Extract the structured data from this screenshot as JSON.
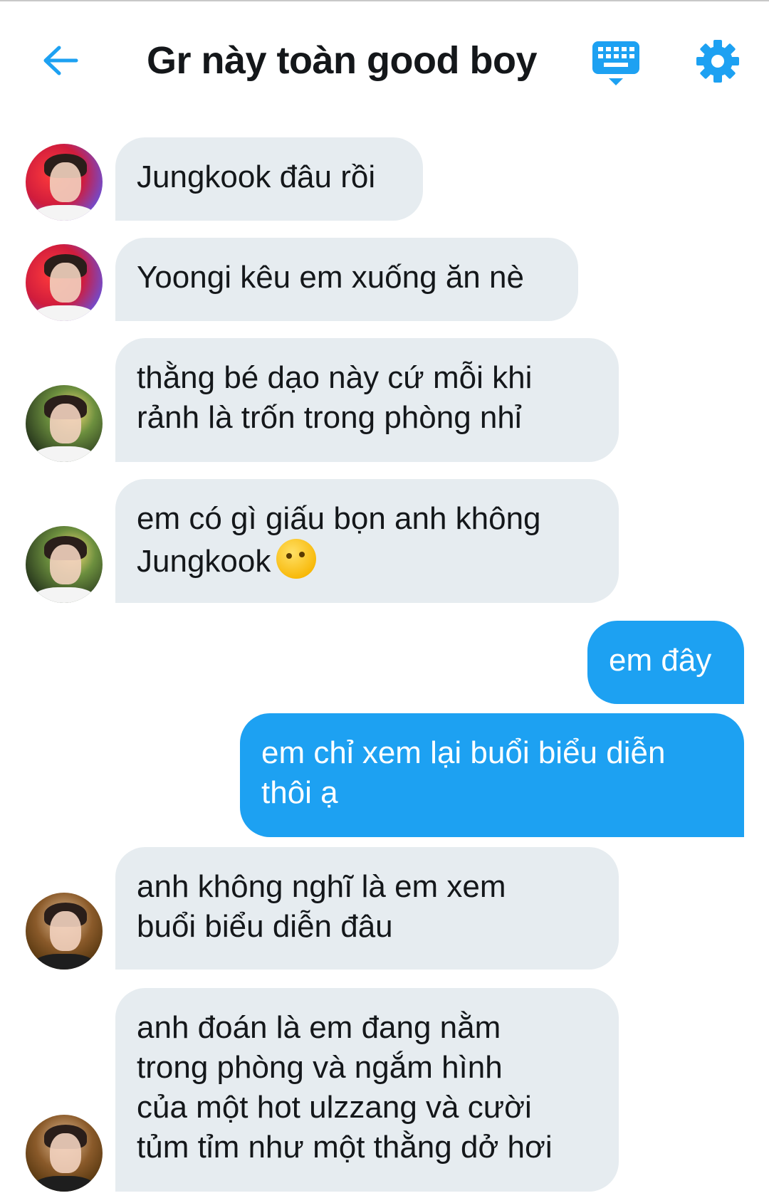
{
  "header": {
    "title": "Gr này toàn good boy",
    "icons": {
      "back": "back-arrow-icon",
      "keyboard": "keyboard-icon",
      "settings": "gear-icon"
    },
    "accent_color": "#1da1f2"
  },
  "messages": [
    {
      "side": "incoming",
      "lines": [
        "Jungkook đâu rồi"
      ]
    },
    {
      "side": "incoming",
      "lines": [
        "Yoongi kêu em xuống ăn nè"
      ]
    },
    {
      "side": "incoming",
      "lines": [
        "thằng bé dạo này cứ mỗi khi",
        "rảnh là trốn trong phòng nhỉ"
      ]
    },
    {
      "side": "incoming",
      "lines": [
        "em có gì giấu bọn anh không",
        "Jungkook"
      ],
      "emoji": "thinking-face-emoji"
    },
    {
      "side": "outgoing",
      "lines": [
        "em đây"
      ]
    },
    {
      "side": "outgoing",
      "lines": [
        "em chỉ xem lại buổi biểu diễn",
        "thôi ạ"
      ]
    },
    {
      "side": "incoming",
      "lines": [
        "anh không nghĩ là em xem",
        "buổi biểu diễn đâu"
      ]
    },
    {
      "side": "incoming",
      "lines": [
        "anh đoán là em đang nằm",
        "trong phòng và ngắm hình",
        "của một hot ulzzang và cười",
        "tủm tỉm như một thằng dở hơi"
      ]
    }
  ],
  "colors": {
    "incoming_bubble": "#e6ecf0",
    "outgoing_bubble": "#1da1f2"
  }
}
